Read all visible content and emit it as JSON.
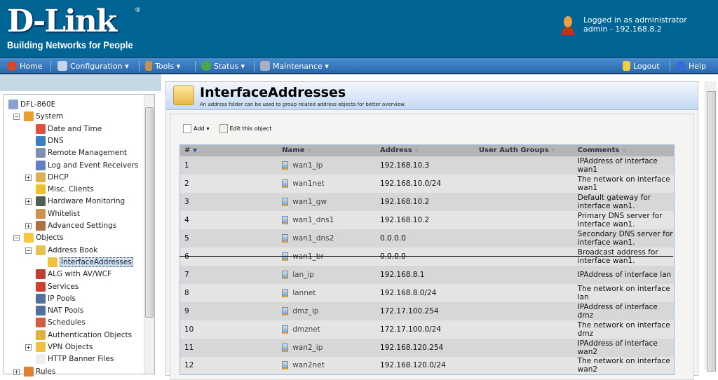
{
  "brand": {
    "name": "D-Link",
    "reg": "®",
    "tagline": "Building Networks for People"
  },
  "user": {
    "line1": "Logged in as administrator",
    "line2": "admin - 192.168.8.2"
  },
  "nav": {
    "home": "Home",
    "configuration": "Configuration ▾",
    "tools": "Tools ▾",
    "status": "Status ▾",
    "maintenance": "Maintenance ▾",
    "logout": "Logout",
    "help": "Help"
  },
  "tree": {
    "root": "DFL-860E",
    "items": [
      "System",
      "Date and Time",
      "DNS",
      "Remote Management",
      "Log and Event Receivers",
      "DHCP",
      "Misc. Clients",
      "Hardware Monitoring",
      "Whitelist",
      "Advanced Settings",
      "Objects",
      "Address Book",
      "InterfaceAddresses",
      "ALG with AV/WCF",
      "Services",
      "IP Pools",
      "NAT Pools",
      "Schedules",
      "Authentication Objects",
      "VPN Objects",
      "HTTP Banner Files",
      "Rules"
    ]
  },
  "page": {
    "title": "InterfaceAddresses",
    "subtitle": "An address folder can be used to group related address objects for better overview.",
    "add": "Add",
    "edit": "Edit this object"
  },
  "table": {
    "headers": [
      "#",
      "Name",
      "Address",
      "User Auth Groups",
      "Comments"
    ],
    "rows": [
      [
        "1",
        "wan1_ip",
        "192.168.10.3",
        "",
        "IPAddress of interface wan1"
      ],
      [
        "2",
        "wan1net",
        "192.168.10.0/24",
        "",
        "The network on interface wan1"
      ],
      [
        "3",
        "wan1_gw",
        "192.168.10.2",
        "",
        "Default gateway for interface wan1."
      ],
      [
        "4",
        "wan1_dns1",
        "192.168.10.2",
        "",
        "Primary DNS server for interface wan1."
      ],
      [
        "5",
        "wan1_dns2",
        "0.0.0.0",
        "",
        "Secondary DNS server for interface wan1."
      ],
      [
        "6",
        "wan1_br",
        "0.0.0.0",
        "",
        "Broadcast address for interface wan1."
      ],
      [
        "7",
        "lan_ip",
        "192.168.8.1",
        "",
        "IPAddress of interface lan"
      ],
      [
        "8",
        "lannet",
        "192.168.8.0/24",
        "",
        "The network on interface lan"
      ],
      [
        "9",
        "dmz_ip",
        "172.17.100.254",
        "",
        "IPAddress of interface dmz"
      ],
      [
        "10",
        "dmznet",
        "172.17.100.0/24",
        "",
        "The network on interface dmz"
      ],
      [
        "11",
        "wan2_ip",
        "192.168.120.254",
        "",
        "IPAddress of interface wan2"
      ],
      [
        "12",
        "wan2net",
        "192.168.120.0/24",
        "",
        "The network on interface wan2"
      ]
    ]
  }
}
